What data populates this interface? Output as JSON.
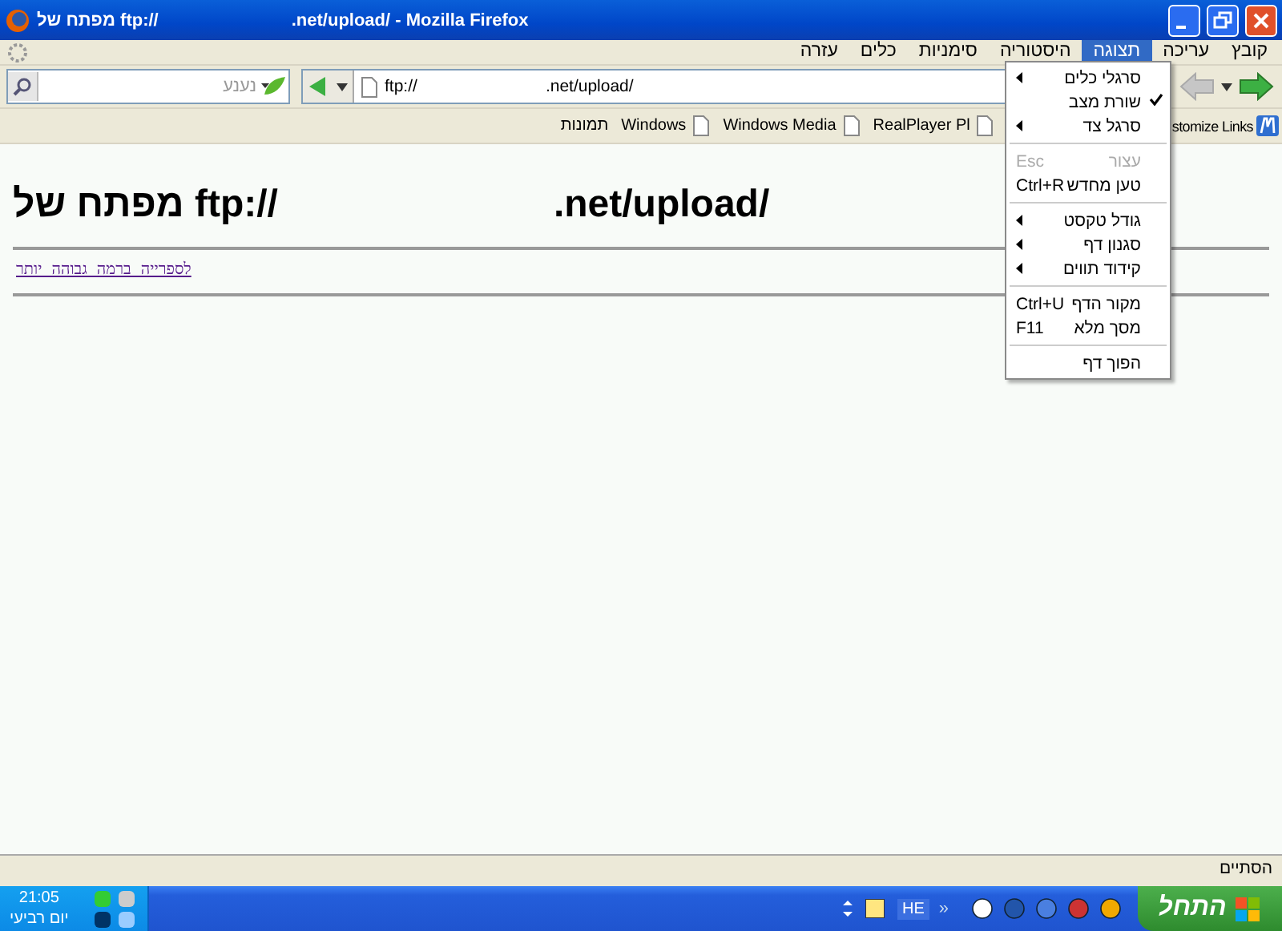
{
  "window": {
    "title_start": "מפתח של ftp://",
    "title_end": ".net/upload/ - Mozilla Firefox"
  },
  "menubar": {
    "items": [
      {
        "label": "קובץ",
        "selected": false
      },
      {
        "label": "עריכה",
        "selected": false
      },
      {
        "label": "תצוגה",
        "selected": true
      },
      {
        "label": "היסטוריה",
        "selected": false
      },
      {
        "label": "סימניות",
        "selected": false
      },
      {
        "label": "כלים",
        "selected": false
      },
      {
        "label": "עזרה",
        "selected": false
      }
    ]
  },
  "navigation": {
    "forward": {
      "disabled": false
    },
    "back": {
      "disabled": true
    },
    "address": {
      "start": "ftp://",
      "end": ".net/upload/"
    },
    "search": {
      "placeholder": "נענע"
    }
  },
  "bookmarks": [
    {
      "label": "stomize Links",
      "kind": "customize"
    },
    {
      "label": "RealPlayer Pl",
      "kind": "page"
    },
    {
      "label": "Windows Media",
      "kind": "page"
    },
    {
      "label": "Windows",
      "kind": "page"
    },
    {
      "label": "תמונות",
      "kind": "plain"
    }
  ],
  "content": {
    "heading_start": "מפתח של ftp://",
    "heading_end": ".net/upload/",
    "parent_link": "לספרייה ברמה גבוהה יותר"
  },
  "view_menu": {
    "items": [
      {
        "kind": "item",
        "label": "סרגלי כלים",
        "submenu": true,
        "checked": false,
        "disabled": false
      },
      {
        "kind": "item",
        "label": "שורת מצב",
        "submenu": false,
        "checked": true,
        "disabled": false
      },
      {
        "kind": "item",
        "label": "סרגל צד",
        "submenu": true,
        "checked": false,
        "disabled": false
      },
      {
        "kind": "separator"
      },
      {
        "kind": "item",
        "label": "עצור",
        "shortcut": "Esc",
        "submenu": false,
        "checked": false,
        "disabled": true
      },
      {
        "kind": "item",
        "label": "טען מחדש",
        "shortcut": "Ctrl+R",
        "submenu": false,
        "checked": false,
        "disabled": false
      },
      {
        "kind": "separator"
      },
      {
        "kind": "item",
        "label": "גודל טקסט",
        "submenu": true,
        "checked": false,
        "disabled": false
      },
      {
        "kind": "item",
        "label": "סגנון דף",
        "submenu": true,
        "checked": false,
        "disabled": false
      },
      {
        "kind": "item",
        "label": "קידוד תווים",
        "submenu": true,
        "checked": false,
        "disabled": false
      },
      {
        "kind": "separator"
      },
      {
        "kind": "item",
        "label": "מקור הדף",
        "shortcut": "Ctrl+U",
        "submenu": false,
        "checked": false,
        "disabled": false
      },
      {
        "kind": "item",
        "label": "מסך מלא",
        "shortcut": "F11",
        "submenu": false,
        "checked": false,
        "disabled": false
      },
      {
        "kind": "separator"
      },
      {
        "kind": "item",
        "label": "הפוך דף",
        "submenu": false,
        "checked": false,
        "disabled": false
      }
    ]
  },
  "status_bar": {
    "text": "הסתיים"
  },
  "taskbar": {
    "start": "התחל",
    "chevron": "«",
    "language": "HE",
    "time": "21:05",
    "day": "יום רביעי"
  }
}
